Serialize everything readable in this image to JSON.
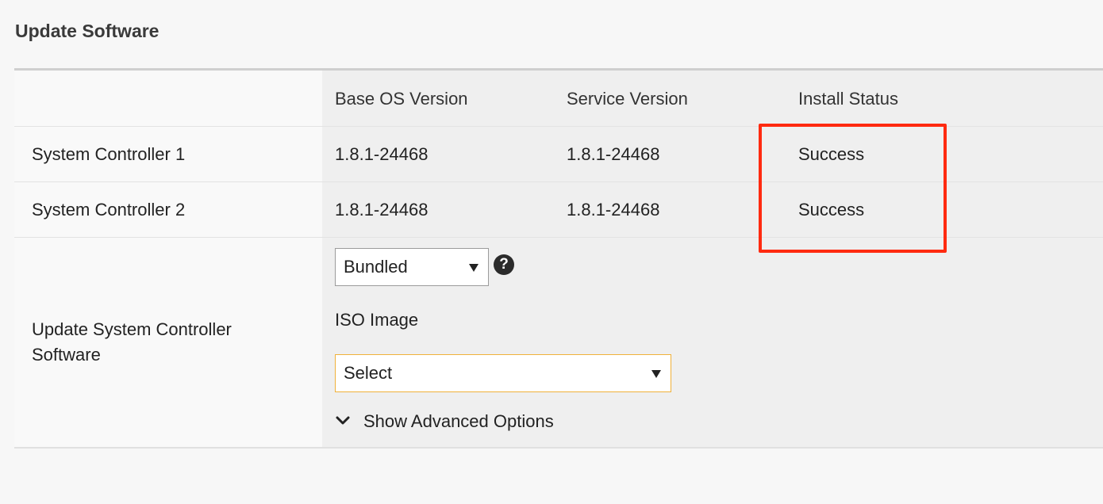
{
  "section": {
    "title": "Update Software"
  },
  "table": {
    "headers": {
      "base_os": "Base OS Version",
      "service": "Service Version",
      "install_status": "Install Status"
    },
    "rows": [
      {
        "name": "System Controller 1",
        "base_os": "1.8.1-24468",
        "service": "1.8.1-24468",
        "status": "Success"
      },
      {
        "name": "System Controller 2",
        "base_os": "1.8.1-24468",
        "service": "1.8.1-24468",
        "status": "Success"
      }
    ]
  },
  "update": {
    "label": "Update System Controller Software",
    "source_select": {
      "value": "Bundled"
    },
    "help_icon": "question-mark-icon",
    "iso_label": "ISO Image",
    "iso_select": {
      "value": "Select"
    },
    "advanced_toggle": "Show Advanced Options",
    "advanced_icon": "chevron-down-icon"
  },
  "annotation": {
    "color": "#ff2a10"
  }
}
